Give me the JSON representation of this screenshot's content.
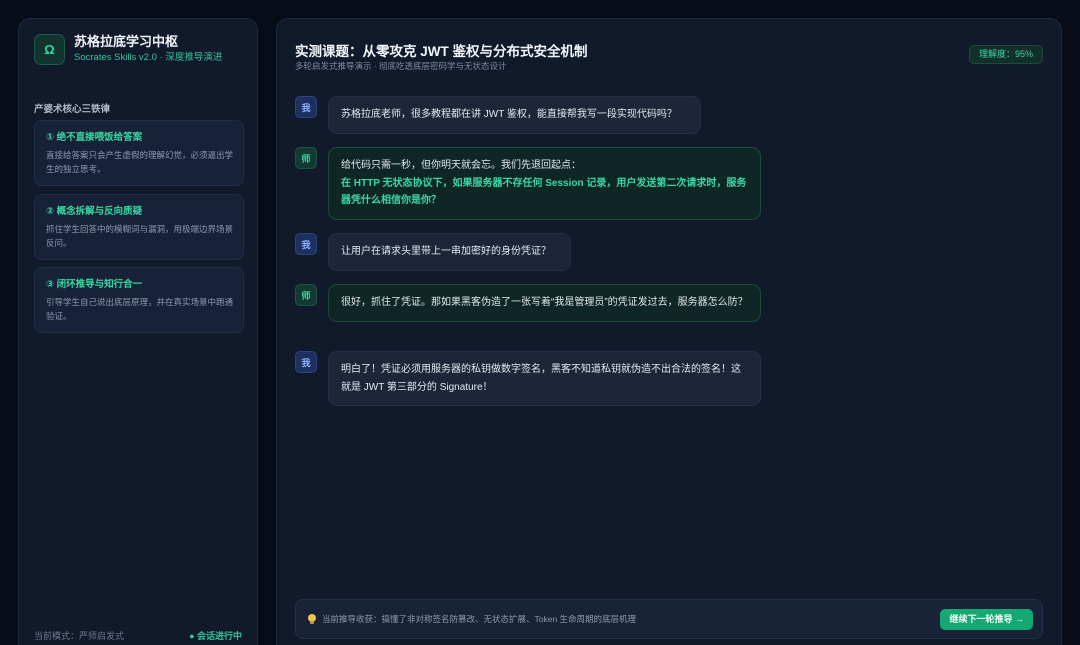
{
  "sidebar": {
    "logo_glyph": "Ω",
    "title": "苏格拉底学习中枢",
    "subtitle": "Socrates Skills v2.0 · 深度推导演进",
    "section_label": "产婆术核心三铁律",
    "rules": [
      {
        "title": "① 绝不直接喂饭给答案",
        "desc": "直接给答案只会产生虚假的理解幻觉，必须逼出学生的独立思考。"
      },
      {
        "title": "② 概念拆解与反向质疑",
        "desc": "抓住学生回答中的模糊词与漏洞，用极端边界场景反问。"
      },
      {
        "title": "③ 闭环推导与知行合一",
        "desc": "引导学生自己说出底层原理，并在真实场景中跑通验证。"
      }
    ],
    "mode_text": "当前模式：严师启发式",
    "status_text": "● 会话进行中"
  },
  "main": {
    "title": "实测课题：从零攻克 JWT 鉴权与分布式安全机制",
    "subtitle": "多轮启发式推导演示 · 彻底吃透底层密码学与无状态设计",
    "progress_badge": "理解度：95%",
    "messages": [
      {
        "role": "me",
        "avatar": "我",
        "text": "苏格拉底老师，很多教程都在讲 JWT 鉴权，能直接帮我写一段实现代码吗？"
      },
      {
        "role": "teacher",
        "avatar": "师",
        "text": "给代码只需一秒，但你明天就会忘。我们先退回起点：",
        "highlight": "在 HTTP 无状态协议下，如果服务器不存任何 Session 记录，用户发送第二次请求时，服务器凭什么相信你是你？"
      },
      {
        "role": "me",
        "avatar": "我",
        "text": "让用户在请求头里带上一串加密好的身份凭证？"
      },
      {
        "role": "teacher",
        "avatar": "师",
        "text": "很好，抓住了凭证。那如果黑客伪造了一张写着“我是管理员”的凭证发过去，服务器怎么防？"
      },
      {
        "role": "me",
        "avatar": "我",
        "text": "明白了！凭证必须用服务器的私钥做数字签名，黑客不知道私钥就伪造不出合法的签名！这就是 JWT 第三部分的 Signature！"
      }
    ],
    "bottom": {
      "text": "当前推导收获：搞懂了非对称签名防篡改、无状态扩展、Token 生命周期的底层机理",
      "button_label": "继续下一轮推导 →"
    }
  }
}
